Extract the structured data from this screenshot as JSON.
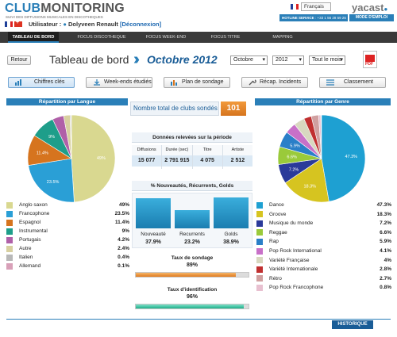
{
  "header": {
    "logo_club": "CLUB",
    "logo_monitoring": "MONITORING",
    "tagline": "SUIVI DES DIFFUSIONS MUSICALES EN DISCOTHEQUES",
    "user_label": "Utilisateur :",
    "user_name": "Dolyveen Renault",
    "logout": "[Déconnexion]",
    "language": "Français",
    "brand": "yacast",
    "hotline_label": "HOTLINE SERVICE",
    "hotline_number": ": +33 1 56 28 59 26",
    "mode_emploi": "MODE D'EMPLOI"
  },
  "nav": {
    "tabs": [
      {
        "label": "TABLEAU DE BORD",
        "active": true
      },
      {
        "label": "FOCUS DISCOTHEQUE",
        "active": false
      },
      {
        "label": "FOCUS WEEK-END",
        "active": false
      },
      {
        "label": "FOCUS TITRE",
        "active": false
      },
      {
        "label": "MAPPING",
        "active": false
      }
    ]
  },
  "toolbar": {
    "back": "Retour",
    "title": "Tableau de bord",
    "period": "Octobre 2012",
    "month": "Octobre",
    "year": "2012",
    "range": "Tout le mois",
    "pdf": "PDF"
  },
  "actions": {
    "chiffres": "Chiffres clés",
    "weekends": "Week-ends étudiés",
    "plan": "Plan de sondage",
    "recap": "Récap. Incidents",
    "classement": "Classement"
  },
  "left_panel": {
    "title": "Répartition par Langue",
    "items": [
      {
        "label": "Anglo saxon",
        "pct": "49%",
        "color": "#d9d890"
      },
      {
        "label": "Francophone",
        "pct": "23.5%",
        "color": "#2a9fd6"
      },
      {
        "label": "Espagnol",
        "pct": "11.4%",
        "color": "#d6741e"
      },
      {
        "label": "Instrumental",
        "pct": "9%",
        "color": "#1e9e8a"
      },
      {
        "label": "Portugais",
        "pct": "4.2%",
        "color": "#b060a8"
      },
      {
        "label": "Autre",
        "pct": "2.4%",
        "color": "#d8d0a0"
      },
      {
        "label": "Italien",
        "pct": "0.4%",
        "color": "#b8b8b8"
      },
      {
        "label": "Allemand",
        "pct": "0.1%",
        "color": "#d8a0b8"
      }
    ]
  },
  "right_panel": {
    "title": "Répartition par Genre",
    "items": [
      {
        "label": "Dance",
        "pct": "47.3%",
        "color": "#1ea0d2"
      },
      {
        "label": "Groove",
        "pct": "18.3%",
        "color": "#d6c420"
      },
      {
        "label": "Musique du monde",
        "pct": "7.2%",
        "color": "#2a3a9a"
      },
      {
        "label": "Reggae",
        "pct": "6.6%",
        "color": "#9aca3a"
      },
      {
        "label": "Rap",
        "pct": "5.9%",
        "color": "#2a7fc8"
      },
      {
        "label": "Pop Rock International",
        "pct": "4.1%",
        "color": "#c870c8"
      },
      {
        "label": "Variété Française",
        "pct": "4%",
        "color": "#d8d8c0"
      },
      {
        "label": "Variété Internationale",
        "pct": "2.8%",
        "color": "#c03030"
      },
      {
        "label": "Rétro",
        "pct": "2.7%",
        "color": "#d0a0a0"
      },
      {
        "label": "Pop Rock Francophone",
        "pct": "0.8%",
        "color": "#e8c0d0"
      }
    ]
  },
  "middle": {
    "total_label": "Nombre total de clubs sondés",
    "total_value": "101",
    "data_title": "Données relevées sur la période",
    "data_headers": [
      "Diffusions",
      "Durée (sec)",
      "Titre",
      "Artiste"
    ],
    "data_values": [
      "15 077",
      "2 791 915",
      "4 075",
      "2 512"
    ],
    "nrg_title": "% Nouveautés, Récurrents, Golds",
    "nrg": [
      {
        "label": "Nouveauté",
        "value": "37.9%",
        "level": 37.9
      },
      {
        "label": "Recurrents",
        "value": "23.2%",
        "level": 23.2
      },
      {
        "label": "Golds",
        "value": "38.9%",
        "level": 38.9
      }
    ],
    "sondage_title": "Taux de sondage",
    "sondage_value": "89%",
    "sondage_level": 89,
    "ident_title": "Taux d'identification",
    "ident_value": "96%",
    "ident_level": 96
  },
  "footer": {
    "historique": "HISTORIQUE"
  }
}
